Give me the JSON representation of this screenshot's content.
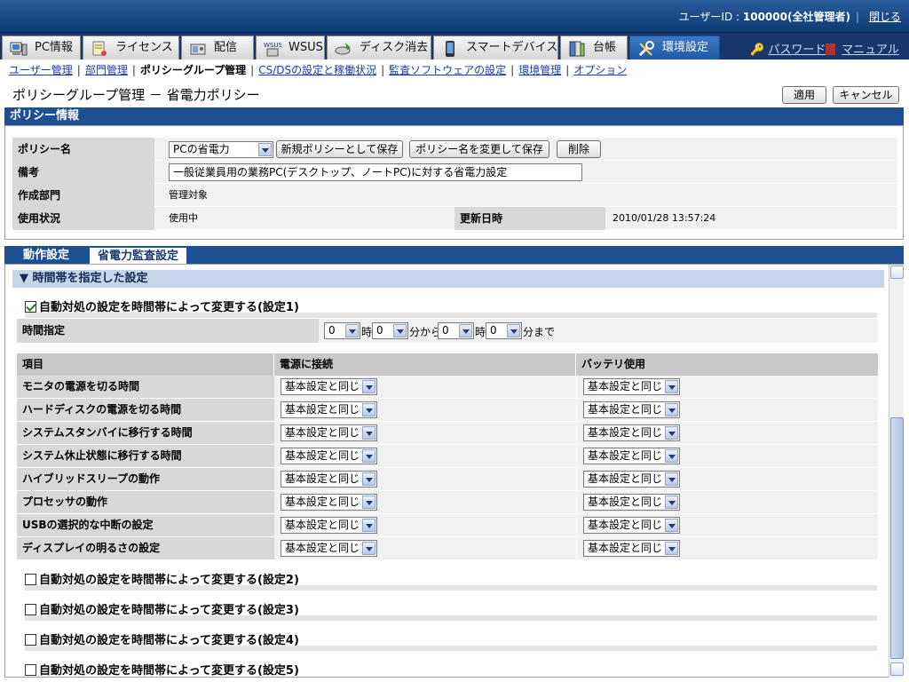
{
  "header": {
    "user_label": "ユーザーID : ",
    "user_value": "100000(全社管理者)",
    "close_label": "閉じる"
  },
  "main_tabs": [
    {
      "label": "PC情報",
      "icon": "pc-icon"
    },
    {
      "label": "ライセンス",
      "icon": "license-icon"
    },
    {
      "label": "配信",
      "icon": "delivery-icon"
    },
    {
      "label": "WSUS",
      "icon": "wsus-icon"
    },
    {
      "label": "ディスク消去",
      "icon": "disk-erase-icon"
    },
    {
      "label": "スマートデバイス",
      "icon": "smart-device-icon"
    },
    {
      "label": "台帳",
      "icon": "ledger-icon"
    },
    {
      "label": "環境設定",
      "icon": "tools-icon",
      "active": true
    }
  ],
  "top_links": {
    "password": "パスワード",
    "manual": "マニュアル"
  },
  "sub_nav": [
    "ユーザー管理",
    "部門管理",
    "ポリシーグループ管理",
    "CS/DSの設定と稼働状況",
    "監査ソフトウェアの設定",
    "環境管理",
    "オプション"
  ],
  "page": {
    "title": "ポリシーグループ管理 － 省電力ポリシー",
    "apply_label": "適用",
    "cancel_label": "キャンセル"
  },
  "policy_info": {
    "heading": "ポリシー情報",
    "name_label": "ポリシー名",
    "name_value": "PCの省電力",
    "save_new_label": "新規ポリシーとして保存",
    "rename_label": "ポリシー名を変更して保存",
    "delete_label": "削除",
    "note_label": "備考",
    "note_value": "一般従業員用の業務PC(デスクトップ、ノートPC)に対する省電力設定",
    "dept_label": "作成部門",
    "dept_value": "管理対象",
    "status_label": "使用状況",
    "status_value": "使用中",
    "updated_label": "更新日時",
    "updated_value": "2010/01/28 13:57:24"
  },
  "lower_tabs": {
    "tab1": "動作設定",
    "tab2": "省電力監査設定"
  },
  "time_section": {
    "heading": "▼ 時間帯を指定した設定",
    "setting1_label": "自動対処の設定を時間帯によって変更する(設定1)",
    "setting1_checked": true,
    "time_label": "時間指定",
    "from_hour": "0",
    "from_min": "0",
    "to_hour": "0",
    "to_min": "0",
    "unit_hour": "時",
    "unit_from": "分から",
    "unit_to": "分まで"
  },
  "grid": {
    "col_item": "項目",
    "col_ac": "電源に接続",
    "col_battery": "バッテリ使用",
    "option_value": "基本設定と同じ",
    "rows": [
      "モニタの電源を切る時間",
      "ハードディスクの電源を切る時間",
      "システムスタンバイに移行する時間",
      "システム休止状態に移行する時間",
      "ハイブリッドスリープの動作",
      "プロセッサの動作",
      "USBの選択的な中断の設定",
      "ディスプレイの明るさの設定"
    ]
  },
  "other_settings": [
    {
      "label": "自動対処の設定を時間帯によって変更する(設定2)",
      "checked": false
    },
    {
      "label": "自動対処の設定を時間帯によって変更する(設定3)",
      "checked": false
    },
    {
      "label": "自動対処の設定を時間帯によって変更する(設定4)",
      "checked": false
    },
    {
      "label": "自動対処の設定を時間帯によって変更する(設定5)",
      "checked": false
    }
  ],
  "colors": {
    "header_blue": "#1f4f93",
    "active_tab": "#2b67b4",
    "link": "#1c39b0"
  }
}
